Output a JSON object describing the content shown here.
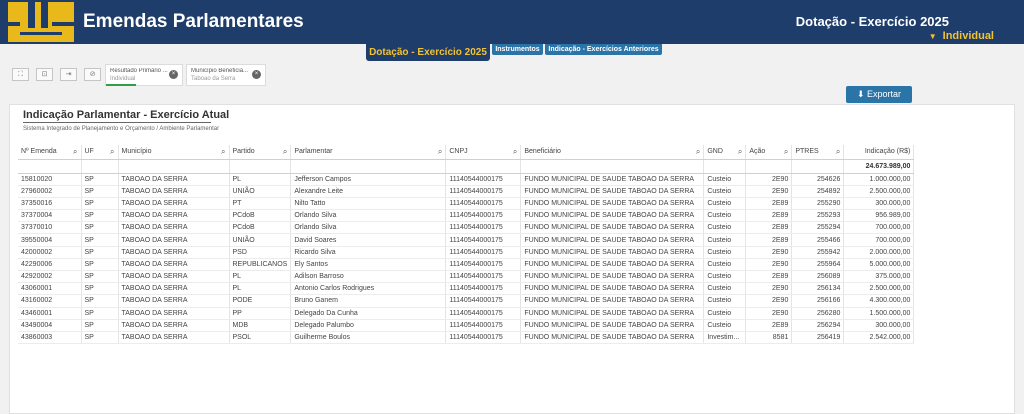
{
  "header": {
    "app_title": "Emendas Parlamentares",
    "right_title": "Dotação - Exercício 2025",
    "right_sub": "Individual"
  },
  "tabs": {
    "main": "Dotação - Exercício 2025",
    "instrumentos": "Instrumentos",
    "indicacao": "Indicação - Exercícios Anteriores"
  },
  "toolbar": {
    "tab1_title": "Resultado Primário ...",
    "tab1_value": "Individual",
    "tab2_title": "Município Beneficiá...",
    "tab2_value": "Taboao da Serra"
  },
  "export_label": "Exportar",
  "panel": {
    "title": "Indicação Parlamentar - Exercício Atual",
    "subtitle": "Sistema Integrado de Planejamento e Orçamento / Ambiente Parlamentar"
  },
  "table": {
    "headers": [
      "Nº Emenda",
      "UF",
      "Município",
      "Partido",
      "Parlamentar",
      "CNPJ",
      "Beneficiário",
      "GND",
      "Ação",
      "PTRES",
      "Indicação (R$)"
    ],
    "total": "24.673.989,00",
    "rows": [
      [
        "15810020",
        "SP",
        "TABOAO DA SERRA",
        "PL",
        "Jefferson Campos",
        "11140544000175",
        "FUNDO MUNICIPAL DE SAUDE TABOAO DA SERRA",
        "Custeio",
        "2E90",
        "254626",
        "1.000.000,00"
      ],
      [
        "27960002",
        "SP",
        "TABOAO DA SERRA",
        "UNIÃO",
        "Alexandre Leite",
        "11140544000175",
        "FUNDO MUNICIPAL DE SAUDE TABOAO DA SERRA",
        "Custeio",
        "2E90",
        "254892",
        "2.500.000,00"
      ],
      [
        "37350016",
        "SP",
        "TABOAO DA SERRA",
        "PT",
        "Nilto Tatto",
        "11140544000175",
        "FUNDO MUNICIPAL DE SAUDE TABOAO DA SERRA",
        "Custeio",
        "2E89",
        "255290",
        "300.000,00"
      ],
      [
        "37370004",
        "SP",
        "TABOAO DA SERRA",
        "PCdoB",
        "Orlando Silva",
        "11140544000175",
        "FUNDO MUNICIPAL DE SAUDE TABOAO DA SERRA",
        "Custeio",
        "2E89",
        "255293",
        "956.989,00"
      ],
      [
        "37370010",
        "SP",
        "TABOAO DA SERRA",
        "PCdoB",
        "Orlando Silva",
        "11140544000175",
        "FUNDO MUNICIPAL DE SAUDE TABOAO DA SERRA",
        "Custeio",
        "2E89",
        "255294",
        "700.000,00"
      ],
      [
        "39550004",
        "SP",
        "TABOAO DA SERRA",
        "UNIÃO",
        "David Soares",
        "11140544000175",
        "FUNDO MUNICIPAL DE SAUDE TABOAO DA SERRA",
        "Custeio",
        "2E89",
        "255466",
        "700.000,00"
      ],
      [
        "42000002",
        "SP",
        "TABOAO DA SERRA",
        "PSD",
        "Ricardo Silva",
        "11140544000175",
        "FUNDO MUNICIPAL DE SAUDE TABOAO DA SERRA",
        "Custeio",
        "2E90",
        "255942",
        "2.000.000,00"
      ],
      [
        "42290006",
        "SP",
        "TABOAO DA SERRA",
        "REPUBLICANOS",
        "Ely Santos",
        "11140544000175",
        "FUNDO MUNICIPAL DE SAUDE TABOAO DA SERRA",
        "Custeio",
        "2E90",
        "255964",
        "5.000.000,00"
      ],
      [
        "42920002",
        "SP",
        "TABOAO DA SERRA",
        "PL",
        "Adilson Barroso",
        "11140544000175",
        "FUNDO MUNICIPAL DE SAUDE TABOAO DA SERRA",
        "Custeio",
        "2E89",
        "256089",
        "375.000,00"
      ],
      [
        "43060001",
        "SP",
        "TABOAO DA SERRA",
        "PL",
        "Antonio Carlos Rodrigues",
        "11140544000175",
        "FUNDO MUNICIPAL DE SAUDE TABOAO DA SERRA",
        "Custeio",
        "2E90",
        "256134",
        "2.500.000,00"
      ],
      [
        "43160002",
        "SP",
        "TABOAO DA SERRA",
        "PODE",
        "Bruno Ganem",
        "11140544000175",
        "FUNDO MUNICIPAL DE SAUDE TABOAO DA SERRA",
        "Custeio",
        "2E90",
        "256166",
        "4.300.000,00"
      ],
      [
        "43460001",
        "SP",
        "TABOAO DA SERRA",
        "PP",
        "Delegado Da Cunha",
        "11140544000175",
        "FUNDO MUNICIPAL DE SAUDE TABOAO DA SERRA",
        "Custeio",
        "2E90",
        "256280",
        "1.500.000,00"
      ],
      [
        "43490004",
        "SP",
        "TABOAO DA SERRA",
        "MDB",
        "Delegado Palumbo",
        "11140544000175",
        "FUNDO MUNICIPAL DE SAUDE TABOAO DA SERRA",
        "Custeio",
        "2E89",
        "256294",
        "300.000,00"
      ],
      [
        "43860003",
        "SP",
        "TABOAO DA SERRA",
        "PSOL",
        "Guilherme Boulos",
        "11140544000175",
        "FUNDO MUNICIPAL DE SAUDE TABOAO DA SERRA",
        "Investim...",
        "8581",
        "256419",
        "2.542.000,00"
      ]
    ]
  }
}
